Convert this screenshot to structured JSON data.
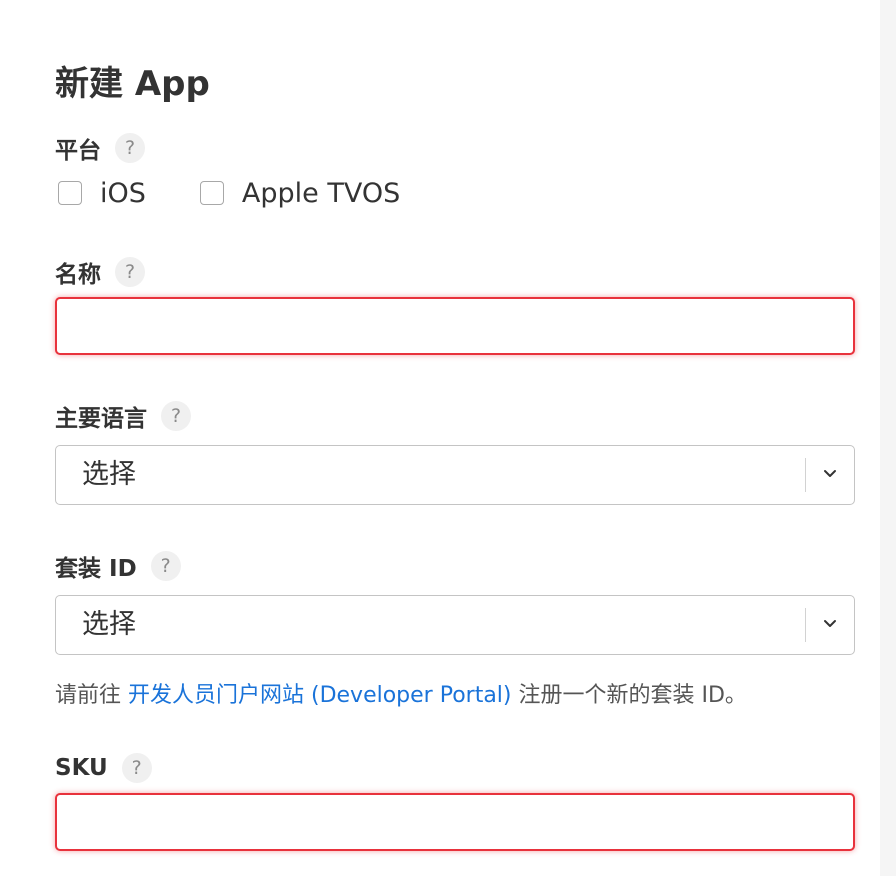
{
  "page": {
    "title": "新建 App"
  },
  "platform": {
    "label": "平台",
    "help": "?",
    "options": [
      {
        "label": "iOS",
        "checked": false
      },
      {
        "label": "Apple TVOS",
        "checked": false
      }
    ]
  },
  "name_field": {
    "label": "名称",
    "help": "?",
    "value": "",
    "state": "error"
  },
  "primary_language": {
    "label": "主要语言",
    "help": "?",
    "selected": "选择"
  },
  "bundle_id": {
    "label": "套装 ID",
    "help": "?",
    "selected": "选择",
    "note_prefix": "请前往 ",
    "note_link": "开发人员门户网站 (Developer Portal)",
    "note_suffix": " 注册一个新的套装 ID。"
  },
  "sku_field": {
    "label": "SKU",
    "help": "?",
    "value": "",
    "state": "error"
  },
  "colors": {
    "error_border": "#e8323c",
    "link": "#1a73d9",
    "text": "#333333"
  },
  "icons": {
    "help": "question-circle-icon",
    "dropdown": "chevron-down-icon",
    "checkbox": "checkbox-unchecked-icon"
  }
}
